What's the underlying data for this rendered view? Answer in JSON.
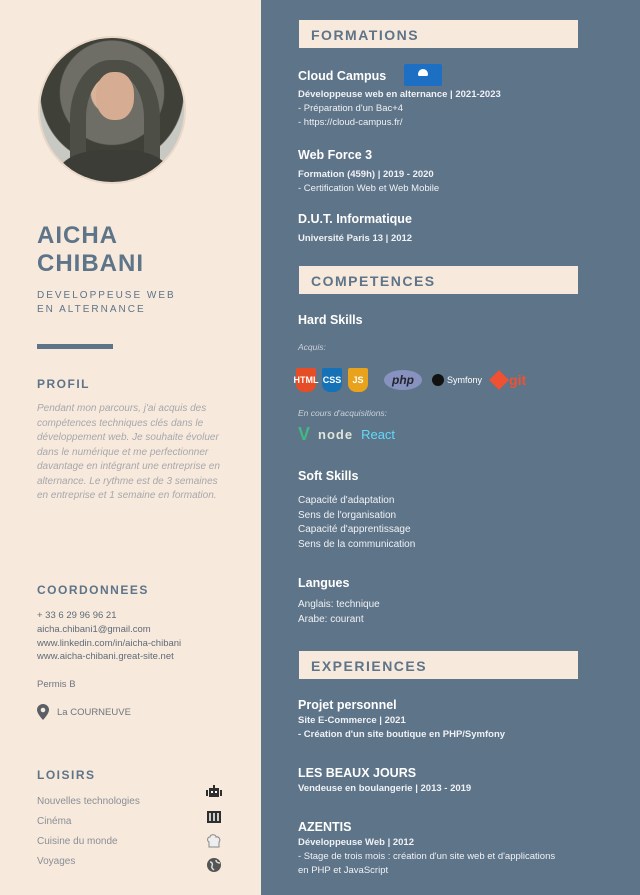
{
  "person": {
    "first_name": "AICHA",
    "last_name": "CHIBANI",
    "role_line1": "DEVELOPPEUSE WEB",
    "role_line2": "EN ALTERNANCE"
  },
  "profil": {
    "title": "PROFIL",
    "text": "Pendant mon parcours, j'ai acquis des compétences techniques clés dans le développement web. Je souhaite évoluer dans le numérique et me perfectionner davantage en intégrant une entreprise en alternance. Le rythme est de 3 semaines en entreprise et 1 semaine en formation."
  },
  "coordonnees": {
    "title": "COORDONNEES",
    "phone": "+ 33 6 29 96 96 21",
    "email": "aicha.chibani1@gmail.com",
    "linkedin": "www.linkedin.com/in/aicha-chibani",
    "website": "www.aicha-chibani.great-site.net",
    "permis": "Permis B",
    "location": "La COURNEUVE"
  },
  "loisirs": {
    "title": "LOISIRS",
    "items": [
      "Nouvelles technologies",
      "Cinéma",
      "Cuisine du monde",
      "Voyages"
    ]
  },
  "formations": {
    "title": "FORMATIONS",
    "items": [
      {
        "name": "Cloud Campus",
        "detail": "Développeuse web  en alternance |  2021-2023",
        "line1": "- Préparation d'un Bac+4",
        "line2": "- https://cloud-campus.fr/"
      },
      {
        "name": "Web Force 3",
        "detail": "Formation (459h)  | 2019 - 2020",
        "line1": "- Certification Web et Web Mobile"
      },
      {
        "name": "D.U.T. Informatique",
        "detail": "Université Paris 13 | 2012"
      }
    ]
  },
  "competences": {
    "title": "COMPETENCES",
    "hard_title": "Hard Skills",
    "acquis_label": "Acquis:",
    "badges": [
      "HTML",
      "CSS",
      "JS"
    ],
    "php": "php",
    "symfony": "Symfony",
    "git": "git",
    "en_cours_label": "En cours d'acquisitions:",
    "vue": "V",
    "node": "node",
    "react": "React",
    "soft_title": "Soft Skills",
    "soft": [
      "Capacité d'adaptation",
      "Sens de l'organisation",
      "Capacité d'apprentissage",
      "Sens de la communication"
    ],
    "langues_title": "Langues",
    "langues": [
      "Anglais: technique",
      "Arabe: courant"
    ]
  },
  "experiences": {
    "title": "EXPERIENCES",
    "items": [
      {
        "name": "Projet personnel",
        "detail": "Site E-Commerce | 2021",
        "line1": "- Création d'un site boutique en PHP/Symfony"
      },
      {
        "name": "LES BEAUX JOURS",
        "detail": "Vendeuse en boulangerie  | 2013 - 2019"
      },
      {
        "name": "AZENTIS",
        "detail": "Développeuse Web  | 2012",
        "line1": "- Stage de trois mois : création d'un site web et d'applications",
        "line2": "en PHP et JavaScript"
      }
    ]
  },
  "colors": {
    "accent": "#5e7489",
    "panel": "#f7e9dc"
  }
}
